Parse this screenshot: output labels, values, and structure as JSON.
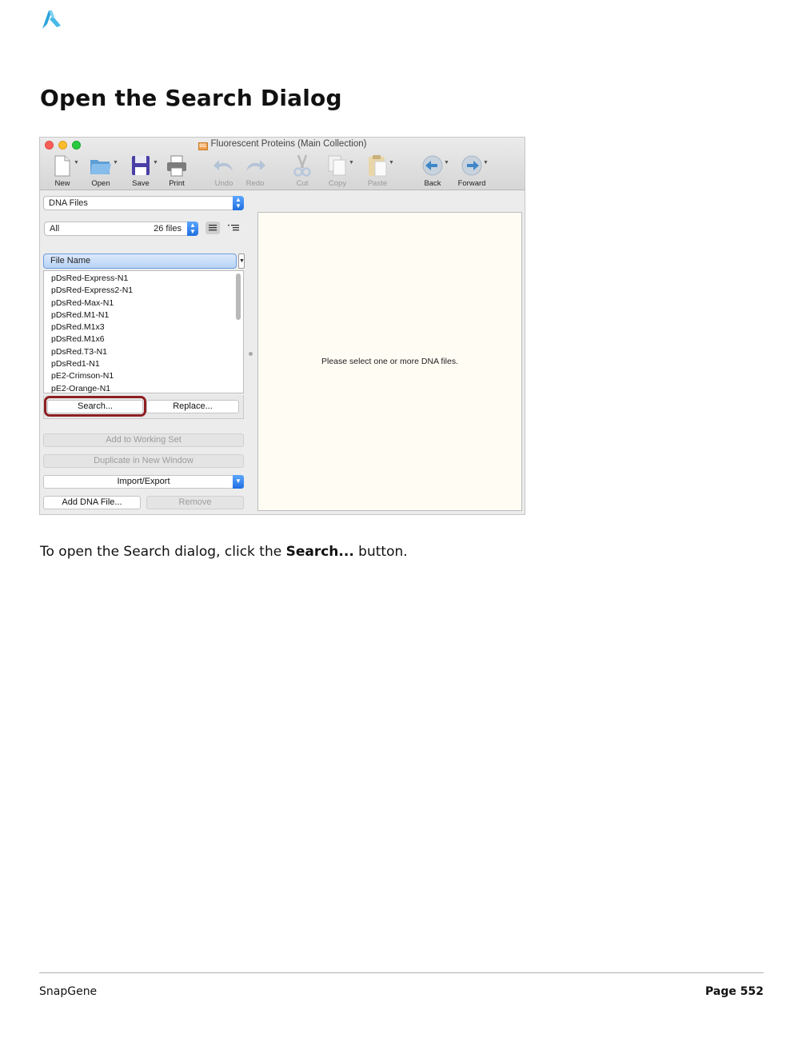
{
  "page": {
    "title": "Open the Search Dialog",
    "instruction_before": "To open the Search dialog, click the ",
    "instruction_bold": "Search...",
    "instruction_after": " button.",
    "footer_left": "SnapGene",
    "footer_right": "Page 552"
  },
  "window": {
    "title": "Fluorescent Proteins  (Main Collection)",
    "doc_badge": "SG",
    "toolbar": [
      {
        "label": "New",
        "icon": "new-document-icon",
        "enabled": true
      },
      {
        "label": "Open",
        "icon": "folder-icon",
        "enabled": true
      },
      {
        "label": "Save",
        "icon": "floppy-disk-icon",
        "enabled": true
      },
      {
        "label": "Print",
        "icon": "printer-icon",
        "enabled": true
      },
      {
        "label": "Undo",
        "icon": "undo-arrow-icon",
        "enabled": false
      },
      {
        "label": "Redo",
        "icon": "redo-arrow-icon",
        "enabled": false
      },
      {
        "label": "Cut",
        "icon": "scissors-icon",
        "enabled": false
      },
      {
        "label": "Copy",
        "icon": "copy-icon",
        "enabled": false
      },
      {
        "label": "Paste",
        "icon": "clipboard-icon",
        "enabled": false
      },
      {
        "label": "Back",
        "icon": "back-arrow-icon",
        "enabled": true
      },
      {
        "label": "Forward",
        "icon": "forward-arrow-icon",
        "enabled": true
      }
    ],
    "file_type_select": "DNA Files",
    "filter_select": "All",
    "file_count": "26 files",
    "column_header": "File Name",
    "files": [
      "pDsRed-Express-N1",
      "pDsRed-Express2-N1",
      "pDsRed-Max-N1",
      "pDsRed.M1-N1",
      "pDsRed.M1x3",
      "pDsRed.M1x6",
      "pDsRed.T3-N1",
      "pDsRed1-N1",
      "pE2-Crimson-N1",
      "pE2-Orange-N1"
    ],
    "search_button": "Search...",
    "replace_button": "Replace...",
    "add_to_working_set": "Add to Working Set",
    "duplicate_button": "Duplicate in New Window",
    "import_export": "Import/Export",
    "add_dna_file": "Add DNA File...",
    "remove_button": "Remove",
    "main_message": "Please select one or more DNA files."
  },
  "colors": {
    "highlight_ring": "#8d1f22",
    "main_pane_bg": "#fffcf4",
    "accent_blue": "#1f6fe0"
  }
}
